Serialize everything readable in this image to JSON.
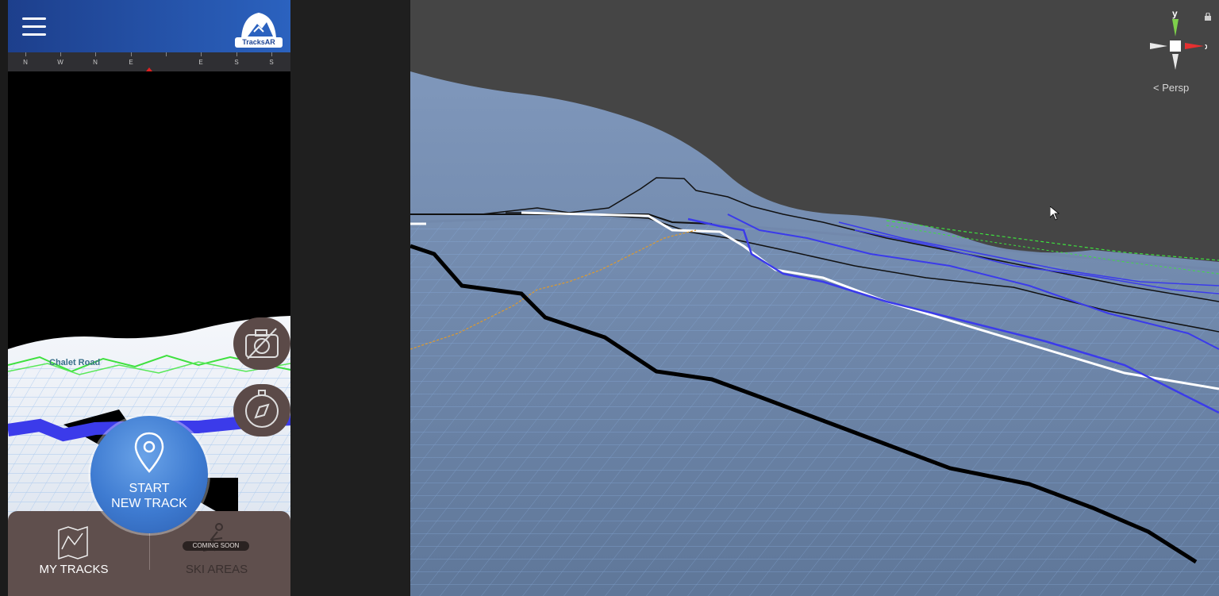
{
  "app": {
    "name": "TracksAR",
    "compass": {
      "labels": [
        "N",
        "W",
        "N",
        "E",
        "E",
        "S",
        "S"
      ]
    },
    "scene": {
      "road_label": "Chalet Road"
    },
    "start_button": {
      "line1": "START",
      "line2": "NEW TRACK"
    },
    "tabs": {
      "my_tracks": "MY TRACKS",
      "ski_areas": "SKI AREAS",
      "ski_areas_badge": "COMING SOON"
    }
  },
  "editor": {
    "gizmo": {
      "y_label": "y",
      "x_label": "x"
    },
    "projection": "Persp"
  },
  "colors": {
    "appbar_start": "#1d3f8c",
    "appbar_end": "#2b62bf",
    "panel_brown": "#5f4f4d",
    "start_blue": "#3e7bd1",
    "track_blue": "#3b3bea",
    "track_green": "#3ee03e",
    "track_orange": "#e09a2a",
    "gizmo_x": "#e53030",
    "gizmo_y": "#7ed04b",
    "terrain": "#6f86a8"
  },
  "icons": [
    "menu-icon",
    "camera-off-icon",
    "compass-icon",
    "location-pin-icon",
    "map-tracks-icon",
    "skier-icon",
    "lock-icon",
    "cursor-icon"
  ]
}
